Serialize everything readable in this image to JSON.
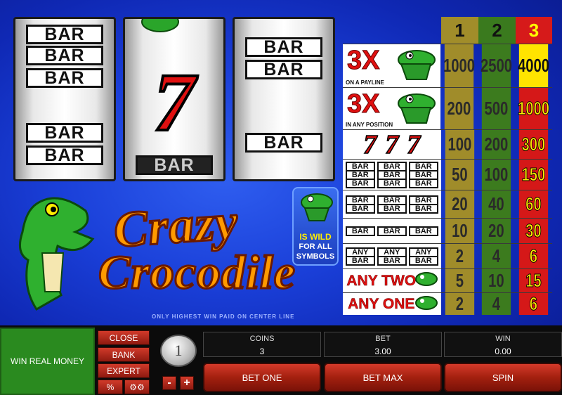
{
  "reels": {
    "reel1": {
      "symbols": [
        "BAR",
        "BAR",
        "BAR",
        "BAR",
        "BAR"
      ]
    },
    "reel2": {
      "seven": "7",
      "bottom_bar": "BAR"
    },
    "reel3": {
      "symbols": [
        "BAR",
        "BAR",
        "BAR"
      ]
    }
  },
  "paytable": {
    "headers": [
      "1",
      "2",
      "3"
    ],
    "rows": [
      {
        "label": "3X",
        "sub": "ON A PAYLINE",
        "values": [
          "1000",
          "2500",
          "4000"
        ]
      },
      {
        "label": "3X",
        "sub": "IN ANY POSITION",
        "values": [
          "200",
          "500",
          "1000"
        ]
      },
      {
        "label": "777",
        "values": [
          "100",
          "200",
          "300"
        ]
      },
      {
        "label": "BAR",
        "values": [
          "50",
          "100",
          "150"
        ]
      },
      {
        "label": "BAR",
        "values": [
          "20",
          "40",
          "60"
        ]
      },
      {
        "label": "BAR",
        "values": [
          "10",
          "20",
          "30"
        ]
      },
      {
        "label": "ANY BAR",
        "values": [
          "2",
          "4",
          "6"
        ]
      },
      {
        "label": "ANY TWO",
        "values": [
          "5",
          "10",
          "15"
        ]
      },
      {
        "label": "ANY ONE",
        "values": [
          "2",
          "4",
          "6"
        ]
      }
    ]
  },
  "logo": {
    "line1": "Crazy",
    "line2": "Crocodile"
  },
  "wild": {
    "line1": "IS WILD",
    "line2": "FOR ALL",
    "line3": "SYMBOLS"
  },
  "note": "ONLY HIGHEST WIN PAID ON CENTER LINE",
  "controls": {
    "win_real_money": "WIN REAL MONEY",
    "close": "CLOSE",
    "bank": "BANK",
    "expert": "EXPERT",
    "percent": "%",
    "coin_value": "1",
    "minus": "-",
    "plus": "+",
    "coins_label": "COINS",
    "coins_value": "3",
    "bet_label": "BET",
    "bet_value": "3.00",
    "win_label": "WIN",
    "win_value": "0.00",
    "bet_one": "BET ONE",
    "bet_max": "BET MAX",
    "spin": "SPIN"
  },
  "colors": {
    "background": "#1a3fd8",
    "col1": "#a18d2a",
    "col2": "#3a7a1e",
    "col3": "#d61a1a",
    "highlight": "#ffe400"
  }
}
